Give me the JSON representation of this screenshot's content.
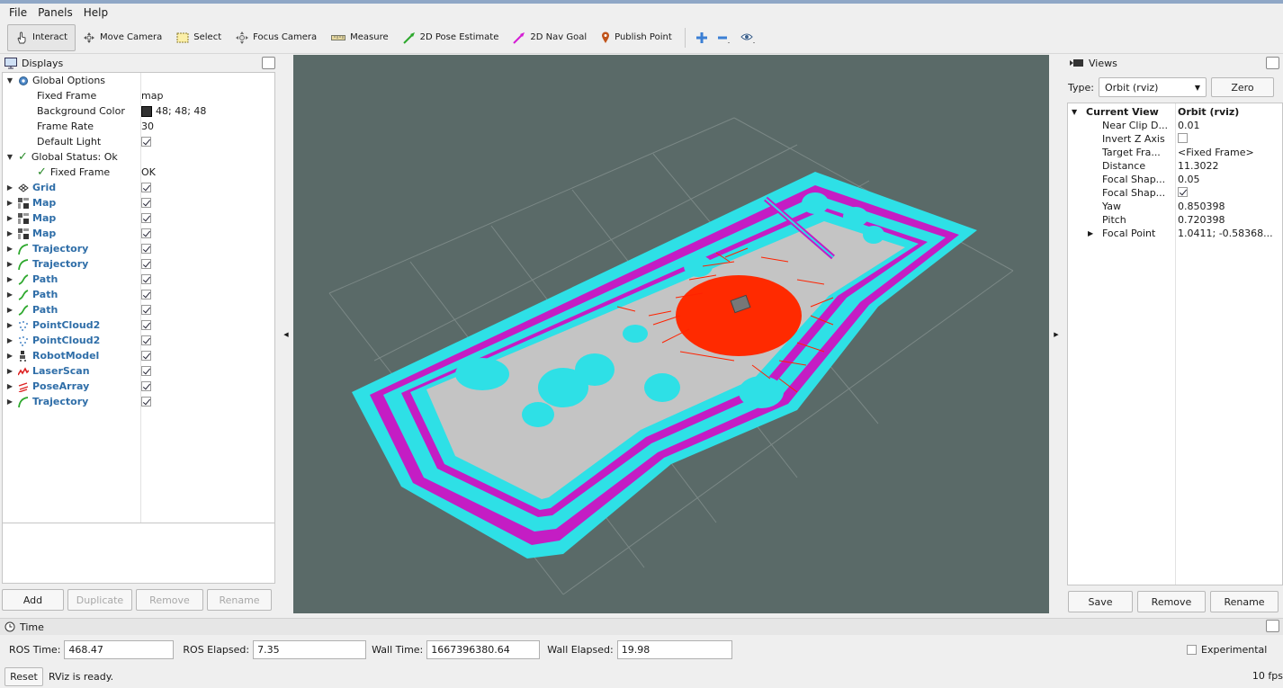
{
  "menu": [
    "File",
    "Panels",
    "Help"
  ],
  "toolbar": {
    "interact": "Interact",
    "move_camera": "Move Camera",
    "select": "Select",
    "focus_camera": "Focus Camera",
    "measure": "Measure",
    "pose_estimate": "2D Pose Estimate",
    "nav_goal": "2D Nav Goal",
    "publish_point": "Publish Point"
  },
  "displays": {
    "title": "Displays",
    "global_options": "Global Options",
    "fixed_frame_label": "Fixed Frame",
    "fixed_frame_value": "map",
    "bg_label": "Background Color",
    "bg_value": "48; 48; 48",
    "frame_rate_label": "Frame Rate",
    "frame_rate_value": "30",
    "default_light_label": "Default Light",
    "global_status": "Global Status: Ok",
    "status_fixed_frame_label": "Fixed Frame",
    "status_fixed_frame_value": "OK",
    "items": [
      {
        "name": "Grid",
        "icon": "grid-icon"
      },
      {
        "name": "Map",
        "icon": "map-icon"
      },
      {
        "name": "Map",
        "icon": "map-icon"
      },
      {
        "name": "Map",
        "icon": "map-icon"
      },
      {
        "name": "Trajectory",
        "icon": "trajectory-icon"
      },
      {
        "name": "Trajectory",
        "icon": "trajectory-icon"
      },
      {
        "name": "Path",
        "icon": "path-icon"
      },
      {
        "name": "Path",
        "icon": "path-icon"
      },
      {
        "name": "Path",
        "icon": "path-icon"
      },
      {
        "name": "PointCloud2",
        "icon": "pointcloud-icon"
      },
      {
        "name": "PointCloud2",
        "icon": "pointcloud-icon"
      },
      {
        "name": "RobotModel",
        "icon": "robot-icon"
      },
      {
        "name": "LaserScan",
        "icon": "laserscan-icon"
      },
      {
        "name": "PoseArray",
        "icon": "posearray-icon"
      },
      {
        "name": "Trajectory",
        "icon": "trajectory-icon"
      }
    ],
    "buttons": {
      "add": "Add",
      "duplicate": "Duplicate",
      "remove": "Remove",
      "rename": "Rename"
    }
  },
  "views": {
    "title": "Views",
    "type_label": "Type:",
    "type_value": "Orbit (rviz)",
    "zero": "Zero",
    "current_view_label": "Current View",
    "current_view_value": "Orbit (rviz)",
    "props": [
      {
        "label": "Near Clip D...",
        "value": "0.01"
      },
      {
        "label": "Invert Z Axis",
        "value": ""
      },
      {
        "label": "Target Fra...",
        "value": "<Fixed Frame>"
      },
      {
        "label": "Distance",
        "value": "11.3022"
      },
      {
        "label": "Focal Shap...",
        "value": "0.05"
      },
      {
        "label": "Focal Shap...",
        "value": ""
      },
      {
        "label": "Yaw",
        "value": "0.850398"
      },
      {
        "label": "Pitch",
        "value": "0.720398"
      },
      {
        "label": "Focal Point",
        "value": "1.0411; -0.58368..."
      }
    ],
    "buttons": {
      "save": "Save",
      "remove": "Remove",
      "rename": "Rename"
    }
  },
  "time": {
    "title": "Time",
    "ros_time_label": "ROS Time:",
    "ros_time": "468.47",
    "ros_elapsed_label": "ROS Elapsed:",
    "ros_elapsed": "7.35",
    "wall_time_label": "Wall Time:",
    "wall_time": "1667396380.64",
    "wall_elapsed_label": "Wall Elapsed:",
    "wall_elapsed": "19.98",
    "experimental": "Experimental"
  },
  "status": {
    "reset": "Reset",
    "message": "RViz is ready.",
    "fps": "10 fps"
  },
  "colors": {
    "viewport_bg": "#5a6a68",
    "costmap_cyan": "#2ee0e6",
    "inflation_magenta": "#c41dc4",
    "map_floor": "#c4c4c4",
    "pose_red": "#ff2200",
    "accent_blue": "#2f6ea8"
  }
}
